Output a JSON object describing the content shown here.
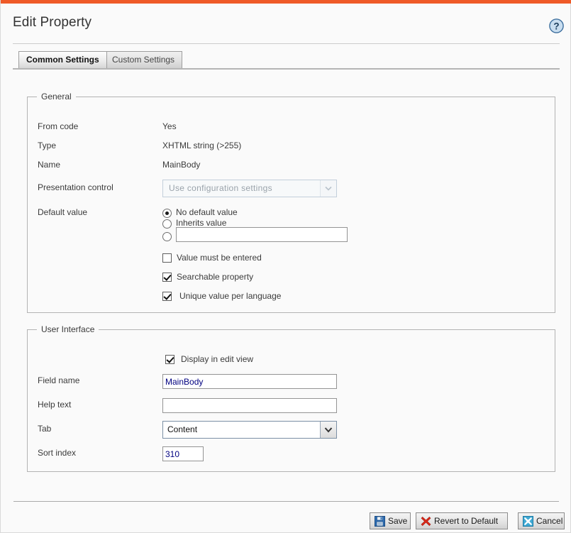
{
  "theme": {
    "accent_orange": "#ef5a28",
    "page_bg": "#fafafa",
    "border": "#b3b3b3",
    "input_text": "#000080"
  },
  "header": {
    "title": "Edit Property",
    "help_icon": "question-mark-circle-icon"
  },
  "tabs": [
    {
      "label": "Common Settings",
      "active": true
    },
    {
      "label": "Custom Settings",
      "active": false
    }
  ],
  "general": {
    "legend": "General",
    "rows": [
      {
        "label": "From code",
        "value": "Yes"
      },
      {
        "label": "Type",
        "value": "XHTML string (>255)"
      },
      {
        "label": "Name",
        "value": "MainBody"
      }
    ],
    "presentation_control": {
      "label": "Presentation control",
      "value": "Use configuration settings",
      "disabled": true,
      "arrow_icon": "chevron-down-icon"
    },
    "default_value": {
      "label": "Default value",
      "options": [
        {
          "label": "No default value",
          "selected": true
        },
        {
          "label": "Inherits value",
          "selected": false
        },
        {
          "label": "",
          "selected": false
        }
      ],
      "custom_value": "",
      "custom_placeholder": ""
    },
    "checkboxes": [
      {
        "label": "Value must be entered",
        "checked": false
      },
      {
        "label": "Searchable property",
        "checked": true
      },
      {
        "label": "Unique value per language",
        "checked": true
      }
    ]
  },
  "user_interface": {
    "legend": "User Interface",
    "display_in_edit_view": {
      "label": "Display in edit view",
      "checked": true
    },
    "field_name": {
      "label": "Field name",
      "value": "MainBody",
      "placeholder": ""
    },
    "help_text": {
      "label": "Help text",
      "value": "",
      "placeholder": ""
    },
    "tab": {
      "label": "Tab",
      "value": "Content",
      "arrow_icon": "chevron-down-icon"
    },
    "sort_index": {
      "label": "Sort index",
      "value": "310",
      "placeholder": ""
    }
  },
  "footer": {
    "buttons": [
      {
        "id": "save",
        "label": "Save",
        "icon": "floppy-disk-save-icon"
      },
      {
        "id": "revert",
        "label": "Revert to Default",
        "icon": "red-x-cross-icon"
      },
      {
        "id": "cancel",
        "label": "Cancel",
        "icon": "cancel-cross-icon"
      }
    ]
  }
}
